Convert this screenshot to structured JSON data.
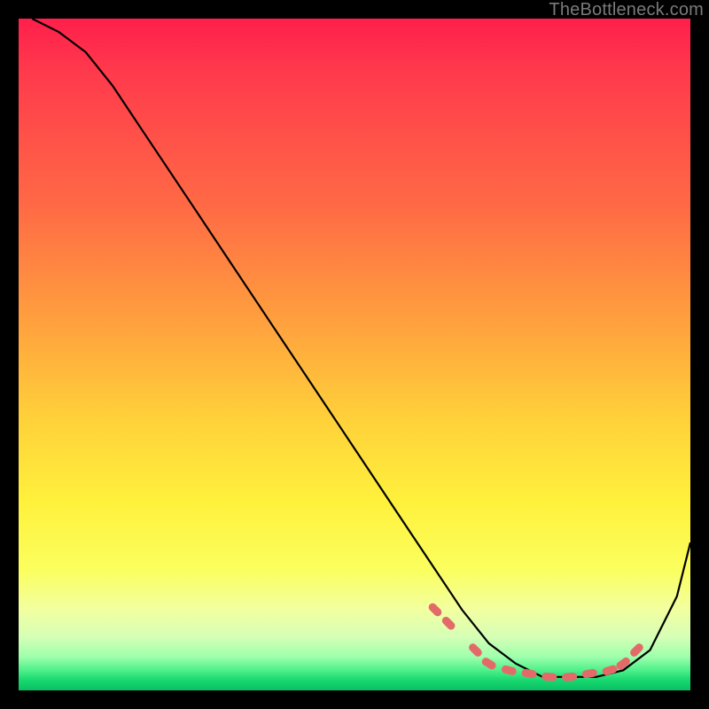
{
  "watermark": "TheBottleneck.com",
  "chart_data": {
    "type": "line",
    "title": "",
    "xlabel": "",
    "ylabel": "",
    "xlim": [
      0,
      100
    ],
    "ylim": [
      0,
      100
    ],
    "grid": false,
    "background_gradient": {
      "direction": "vertical",
      "stops": [
        {
          "pos": 0.0,
          "color": "#ff1f4b"
        },
        {
          "pos": 0.28,
          "color": "#ff6a45"
        },
        {
          "pos": 0.6,
          "color": "#ffd23a"
        },
        {
          "pos": 0.82,
          "color": "#fbff5e"
        },
        {
          "pos": 0.95,
          "color": "#9effac"
        },
        {
          "pos": 1.0,
          "color": "#0abf64"
        }
      ]
    },
    "series": [
      {
        "name": "bottleneck-curve",
        "color": "#000000",
        "x": [
          2,
          6,
          10,
          14,
          18,
          22,
          26,
          30,
          34,
          38,
          42,
          46,
          50,
          54,
          58,
          62,
          66,
          70,
          74,
          78,
          82,
          86,
          90,
          94,
          98,
          100
        ],
        "y": [
          100,
          98,
          95,
          90,
          84,
          78,
          72,
          66,
          60,
          54,
          48,
          42,
          36,
          30,
          24,
          18,
          12,
          7,
          4,
          2,
          2,
          2,
          3,
          6,
          14,
          22
        ]
      }
    ],
    "markers": [
      {
        "name": "highlighted-points",
        "color": "#e46a6a",
        "shape": "rounded-dash",
        "points": [
          {
            "x": 62,
            "y": 12
          },
          {
            "x": 64,
            "y": 10
          },
          {
            "x": 68,
            "y": 6
          },
          {
            "x": 70,
            "y": 4
          },
          {
            "x": 73,
            "y": 3
          },
          {
            "x": 76,
            "y": 2.5
          },
          {
            "x": 79,
            "y": 2
          },
          {
            "x": 82,
            "y": 2
          },
          {
            "x": 85,
            "y": 2.5
          },
          {
            "x": 88,
            "y": 3
          },
          {
            "x": 90,
            "y": 4
          },
          {
            "x": 92,
            "y": 6
          }
        ]
      }
    ]
  }
}
